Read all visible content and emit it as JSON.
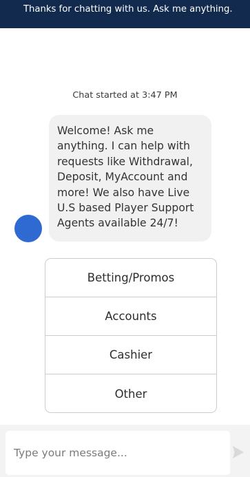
{
  "banner": {
    "text": "Thanks for chatting with us. Ask me anything."
  },
  "chat": {
    "started_text": "Chat started at 3:47 PM",
    "bot_message": "Welcome! Ask me anything. I can help with requests like Withdrawal, Deposit, MyAccount and more! We also have Live U.S based Player Support Agents available 24/7!"
  },
  "options": [
    {
      "label": "Betting/Promos"
    },
    {
      "label": "Accounts"
    },
    {
      "label": "Cashier"
    },
    {
      "label": "Other"
    }
  ],
  "composer": {
    "placeholder": "Type your message..."
  },
  "colors": {
    "banner_bg": "#122a4e",
    "avatar": "#2f6ad3",
    "bubble_bg": "#f1f1f1"
  },
  "icons": {
    "avatar": "bot-avatar-circle",
    "send": "send-icon"
  }
}
